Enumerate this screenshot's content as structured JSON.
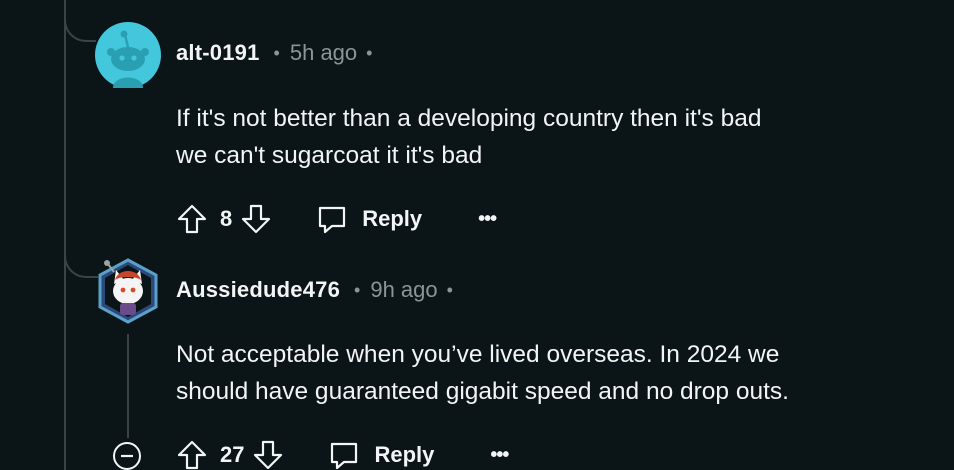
{
  "comments": [
    {
      "username": "alt-0191",
      "separator": "•",
      "time": "5h ago",
      "trailing": "•",
      "lines": [
        "If it's not better than a developing country then it's bad",
        "we can't sugarcoat it it's bad"
      ],
      "votes": "8",
      "reply_label": "Reply",
      "more_label": "•••",
      "avatar_color": "#43c7dc"
    },
    {
      "username": "Aussiedude476",
      "separator": "•",
      "time": "9h ago",
      "trailing": "•",
      "lines": [
        "Not acceptable when you’ve lived overseas. In 2024 we",
        "should have guaranteed gigabit speed and no drop outs."
      ],
      "votes": "27",
      "reply_label": "Reply",
      "more_label": "•••",
      "avatar_color": "#5aa0c8"
    }
  ],
  "colors": {
    "background": "#0b1416",
    "text": "#f2f4f5",
    "muted": "#8a9598",
    "thread_line": "#3a4447"
  }
}
